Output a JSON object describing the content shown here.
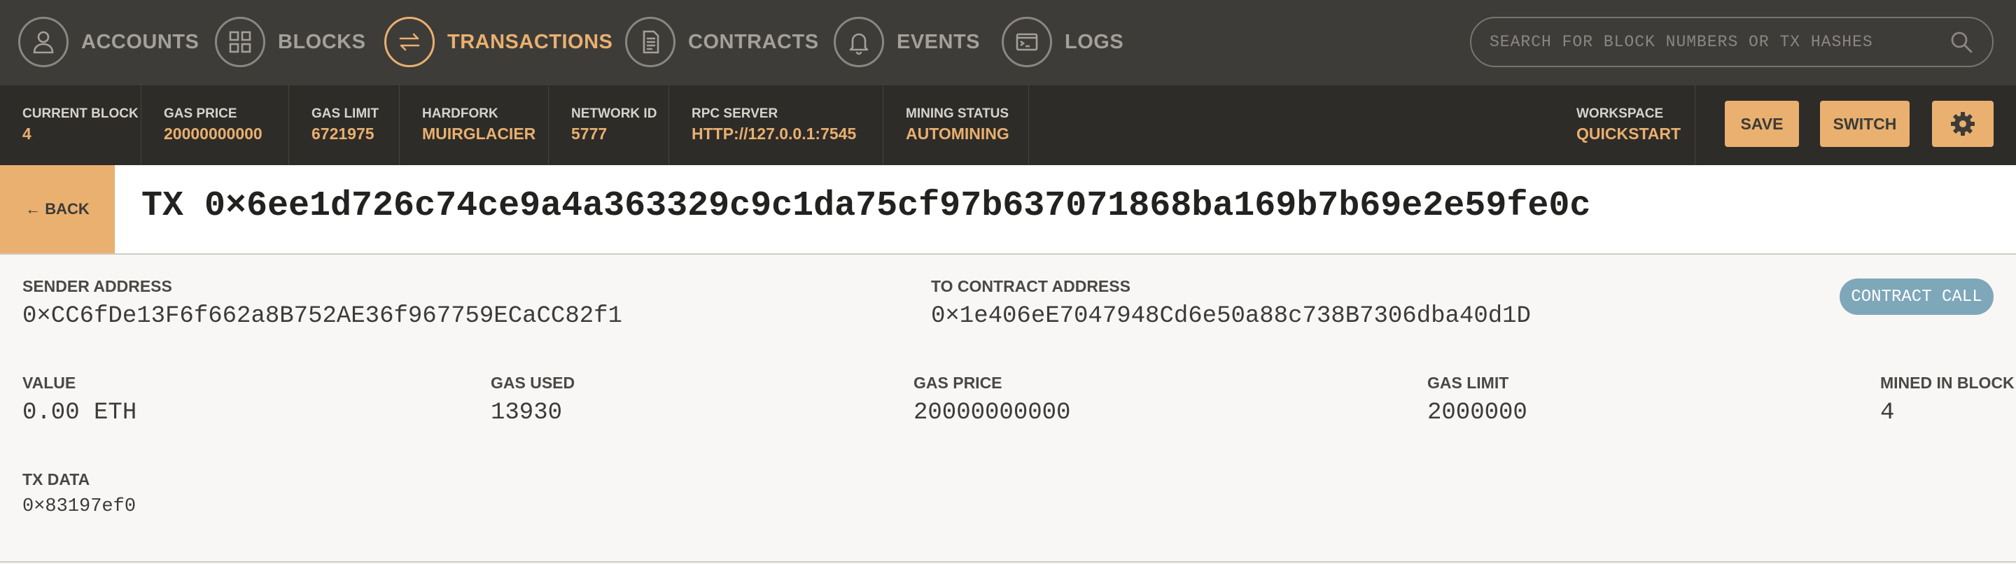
{
  "nav": {
    "items": [
      {
        "label": "ACCOUNTS",
        "icon": "person-icon"
      },
      {
        "label": "BLOCKS",
        "icon": "grid-icon"
      },
      {
        "label": "TRANSACTIONS",
        "icon": "arrows-swap-icon"
      },
      {
        "label": "CONTRACTS",
        "icon": "document-icon"
      },
      {
        "label": "EVENTS",
        "icon": "bell-icon"
      },
      {
        "label": "LOGS",
        "icon": "terminal-icon"
      }
    ],
    "active": "TRANSACTIONS",
    "search_placeholder": "SEARCH FOR BLOCK NUMBERS OR TX HASHES"
  },
  "status": {
    "current_block": {
      "label": "CURRENT BLOCK",
      "value": "4"
    },
    "gas_price": {
      "label": "GAS PRICE",
      "value": "20000000000"
    },
    "gas_limit": {
      "label": "GAS LIMIT",
      "value": "6721975"
    },
    "hardfork": {
      "label": "HARDFORK",
      "value": "MUIRGLACIER"
    },
    "network_id": {
      "label": "NETWORK ID",
      "value": "5777"
    },
    "rpc_server": {
      "label": "RPC SERVER",
      "value": "HTTP://127.0.0.1:7545"
    },
    "mining_status": {
      "label": "MINING STATUS",
      "value": "AUTOMINING"
    },
    "workspace": {
      "label": "WORKSPACE",
      "value": "QUICKSTART"
    },
    "save_label": "SAVE",
    "switch_label": "SWITCH"
  },
  "titlebar": {
    "back_label": "← BACK",
    "title": "TX 0×6ee1d726c74ce9a4a363329c9c1da75cf97b637071868ba169b7b69e2e59fe0c"
  },
  "tx": {
    "sender": {
      "label": "SENDER ADDRESS",
      "value": "0×CC6fDe13F6f662a8B752AE36f967759ECaCC82f1"
    },
    "to_contract": {
      "label": "TO CONTRACT ADDRESS",
      "value": "0×1e406eE7047948Cd6e50a88c738B7306dba40d1D"
    },
    "badge": "CONTRACT CALL",
    "value": {
      "label": "VALUE",
      "value": "0.00 ETH"
    },
    "gas_used": {
      "label": "GAS USED",
      "value": "13930"
    },
    "gas_price": {
      "label": "GAS PRICE",
      "value": "20000000000"
    },
    "gas_limit": {
      "label": "GAS LIMIT",
      "value": "2000000"
    },
    "mined_in_block": {
      "label": "MINED IN BLOCK",
      "value": "4"
    },
    "tx_data": {
      "label": "TX DATA",
      "value": "0×83197ef0"
    }
  },
  "colors": {
    "accent": "#e9b06f",
    "nav_bg": "#3e3c39",
    "status_bg": "#2e2c29",
    "badge": "#7ea7ba",
    "page_bg": "#f8f7f5"
  }
}
